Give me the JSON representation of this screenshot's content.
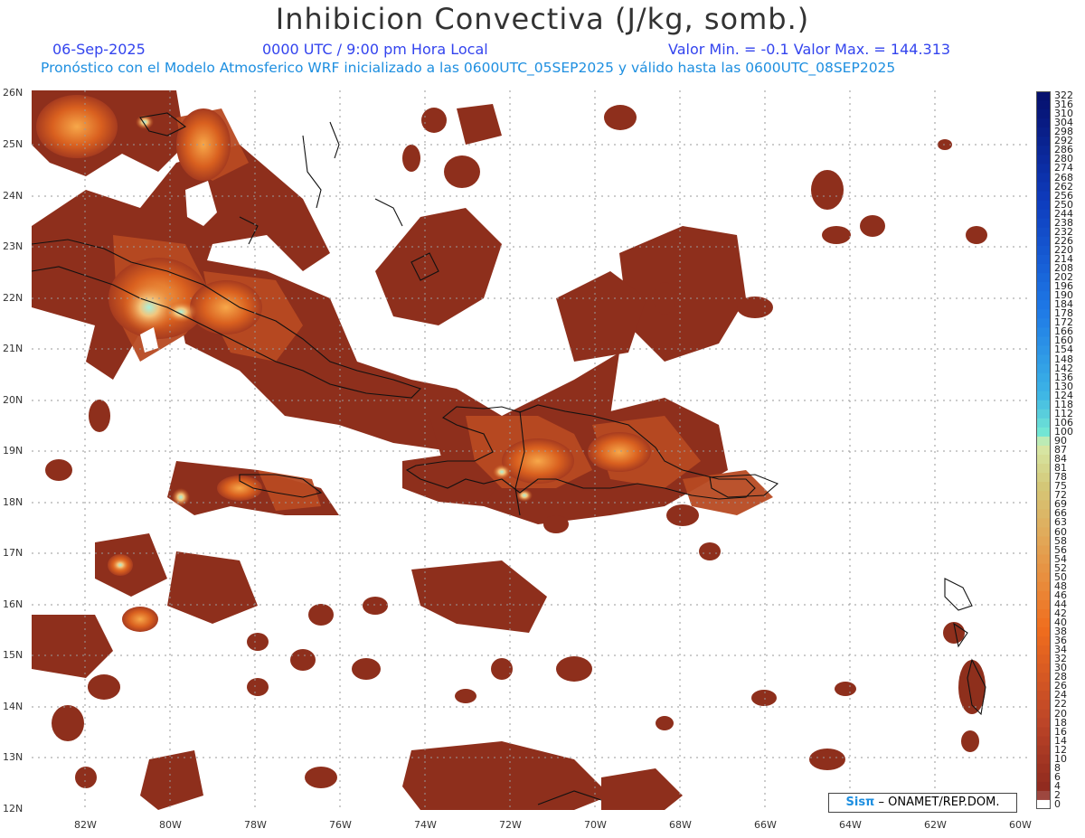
{
  "header": {
    "title": "Inhibicion Convectiva (J/kg, somb.)",
    "date": "06-Sep-2025",
    "time": "0000 UTC / 9:00 pm Hora Local",
    "min_max": "Valor Min. = -0.1  Valor Max. = 144.313",
    "forecast_line": "Pronóstico con el Modelo Atmosferico WRF inicializado a las 0600UTC_05SEP2025 y válido hasta las  0600UTC_08SEP2025"
  },
  "axes": {
    "lat_labels": [
      "26N",
      "25N",
      "24N",
      "23N",
      "22N",
      "21N",
      "20N",
      "19N",
      "18N",
      "17N",
      "16N",
      "15N",
      "14N",
      "13N",
      "12N"
    ],
    "lon_labels": [
      "82W",
      "80W",
      "78W",
      "76W",
      "74W",
      "72W",
      "70W",
      "68W",
      "66W",
      "64W",
      "62W",
      "60W"
    ]
  },
  "colorbar": {
    "labels": [
      "322",
      "316",
      "310",
      "304",
      "298",
      "292",
      "286",
      "280",
      "274",
      "268",
      "262",
      "256",
      "250",
      "244",
      "238",
      "232",
      "226",
      "220",
      "214",
      "208",
      "202",
      "196",
      "190",
      "184",
      "178",
      "172",
      "166",
      "160",
      "154",
      "148",
      "142",
      "136",
      "130",
      "124",
      "118",
      "112",
      "106",
      "100",
      "90",
      "87",
      "84",
      "81",
      "78",
      "75",
      "72",
      "69",
      "66",
      "63",
      "60",
      "58",
      "56",
      "54",
      "52",
      "50",
      "48",
      "46",
      "44",
      "42",
      "40",
      "38",
      "36",
      "34",
      "32",
      "30",
      "28",
      "26",
      "24",
      "22",
      "20",
      "18",
      "16",
      "14",
      "12",
      "10",
      "8",
      "6",
      "4",
      "2",
      "0"
    ]
  },
  "credit": {
    "logo": "Sisπ",
    "text": " – ONAMET/REP.DOM."
  },
  "colors": {
    "field_dark": "#8a2e1c",
    "field_mid": "#b8451f",
    "field_hot": "#e8782a",
    "field_peak": "#9fe8d8",
    "grid": "#9a9a9a",
    "title_blue": "#3344ee",
    "subtitle_cyan": "#1e8fe0"
  }
}
